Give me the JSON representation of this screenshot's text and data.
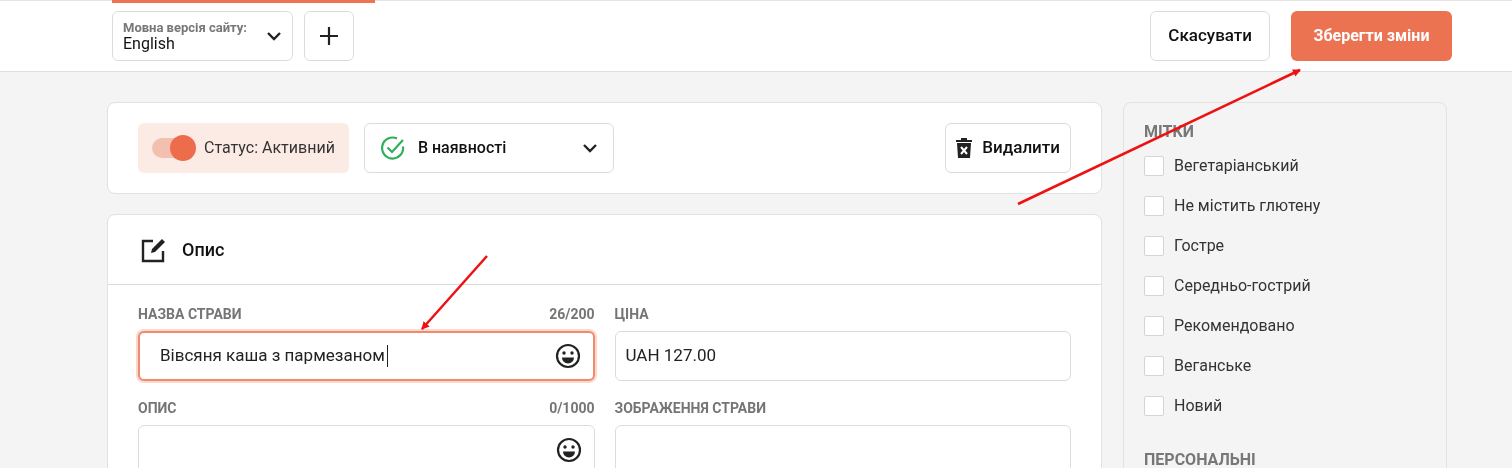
{
  "top_bar": {
    "language_select": {
      "label": "Мовна версія сайту:",
      "value": "English"
    },
    "cancel_button": "Скасувати",
    "save_button": "Зберегти зміни"
  },
  "status_card": {
    "status_toggle": {
      "label": "Статус: Активний",
      "on": true
    },
    "availability_select": {
      "value": "В наявності"
    },
    "delete_button": "Видалити"
  },
  "description_card": {
    "title": "Опис",
    "fields": [
      {
        "kind": "emoji-text",
        "label": "НАЗВА СТРАВИ",
        "counter": "26/200",
        "value": "Вівсяня каша з пармезаном",
        "focused": true
      },
      {
        "kind": "text",
        "label": "ЦІНА",
        "value": "UAH 127.00",
        "focused": false
      },
      {
        "kind": "emoji-text",
        "label": "ОПИС",
        "counter": "0/1000",
        "focused": false
      },
      {
        "kind": "image",
        "label": "ЗОБРАЖЕННЯ СТРАВИ",
        "focused": false
      }
    ]
  },
  "tags_panel": {
    "title": "МІТКИ",
    "tags": [
      {
        "label": "Вегетаріанський",
        "checked": false
      },
      {
        "label": "Не містить глютену",
        "checked": false
      },
      {
        "label": "Гостре",
        "checked": false
      },
      {
        "label": "Середньо-гострий",
        "checked": false
      },
      {
        "label": "Рекомендовано",
        "checked": false
      },
      {
        "label": "Веганське",
        "checked": false
      },
      {
        "label": "Новий",
        "checked": false
      }
    ],
    "personal_title": "ПЕРСОНАЛЬНІ"
  }
}
